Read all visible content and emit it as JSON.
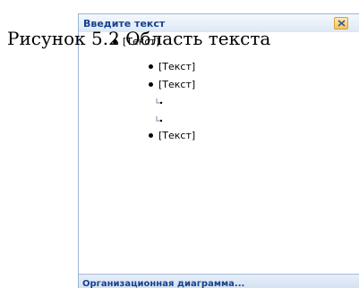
{
  "pane": {
    "title": "Введите текст",
    "close_icon": "close-icon",
    "items": [
      {
        "text": "[Текст]",
        "level": 1
      },
      {
        "text": "[Текст]",
        "level": 2
      },
      {
        "text": "[Текст]",
        "level": 2
      },
      {
        "text": "",
        "level": 3
      },
      {
        "text": "",
        "level": 3
      },
      {
        "text": "[Текст]",
        "level": 2
      }
    ],
    "footer_link": "Организационная диаграмма..."
  },
  "caption": "Рисунок 5.2 Область текста"
}
